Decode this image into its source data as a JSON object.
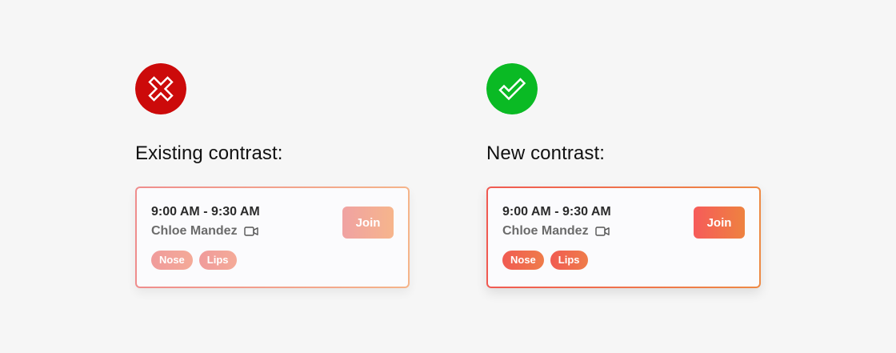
{
  "colors": {
    "page_background": "#f6f6f6",
    "bad_icon_background": "#cc0a0a",
    "good_icon_background": "#0aba24"
  },
  "existing": {
    "status_icon": "x-icon",
    "heading": "Existing contrast:",
    "card": {
      "time": "9:00 AM - 9:30 AM",
      "name": "Chloe Mandez",
      "join_label": "Join",
      "tags": [
        "Nose",
        "Lips"
      ],
      "video_icon": "video-camera-icon"
    }
  },
  "new": {
    "status_icon": "check-icon",
    "heading": "New contrast:",
    "card": {
      "time": "9:00 AM - 9:30 AM",
      "name": "Chloe Mandez",
      "join_label": "Join",
      "tags": [
        "Nose",
        "Lips"
      ],
      "video_icon": "video-camera-icon"
    }
  }
}
